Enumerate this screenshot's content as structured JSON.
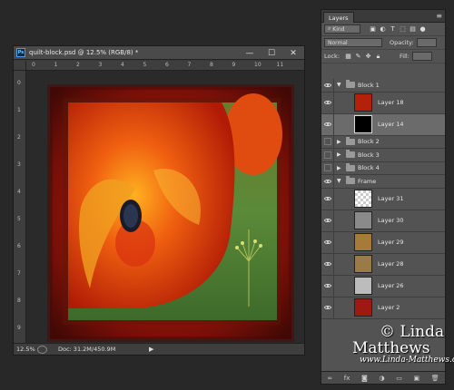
{
  "document": {
    "title": "quilt-block.psd @ 12.5% (RGB/8) *",
    "ps_badge": "Ps",
    "window_buttons": [
      "—",
      "☐",
      "✕"
    ],
    "ruler_top": [
      "0",
      "1",
      "2",
      "3",
      "4",
      "5",
      "6",
      "7",
      "8",
      "9",
      "10",
      "11"
    ],
    "ruler_left": [
      "0",
      "1",
      "2",
      "3",
      "4",
      "5",
      "6",
      "7",
      "8",
      "9"
    ],
    "zoom": "12.5%",
    "doc_info": "Doc: 31.2M/450.9M"
  },
  "layers_panel": {
    "tab": "Layers",
    "filter_kind": "Kind",
    "blend_mode": "Normal",
    "opacity_label": "Opacity:",
    "lock_label": "Lock:",
    "fill_label": "Fill:",
    "layers": [
      {
        "name": "Block 1",
        "type": "group-open",
        "visible": true
      },
      {
        "name": "Layer 18",
        "type": "layer",
        "visible": true,
        "thumb": "#b5200a"
      },
      {
        "name": "Layer 14",
        "type": "layer",
        "visible": true,
        "thumb": "#000000",
        "selected": true
      },
      {
        "name": "Block 2",
        "type": "group",
        "visible": false
      },
      {
        "name": "Block 3",
        "type": "group",
        "visible": false
      },
      {
        "name": "Block 4",
        "type": "group",
        "visible": false
      },
      {
        "name": "Frame",
        "type": "group-open",
        "visible": true
      },
      {
        "name": "Layer 31",
        "type": "layer",
        "visible": true,
        "thumb": "checker"
      },
      {
        "name": "Layer 30",
        "type": "layer",
        "visible": true,
        "thumb": "#8a8a8a"
      },
      {
        "name": "Layer 29",
        "type": "layer",
        "visible": true,
        "thumb": "#a87a3a"
      },
      {
        "name": "Layer 28",
        "type": "layer",
        "visible": true,
        "thumb": "#9a7a45"
      },
      {
        "name": "Layer 26",
        "type": "layer",
        "visible": true,
        "thumb": "#bcbcbc"
      },
      {
        "name": "Layer 2",
        "type": "layer",
        "visible": true,
        "thumb": "#9e1a10"
      }
    ]
  },
  "watermark": {
    "line1": "© Linda",
    "line2": "Matthews",
    "line3": "www.Linda-Matthews.com"
  }
}
